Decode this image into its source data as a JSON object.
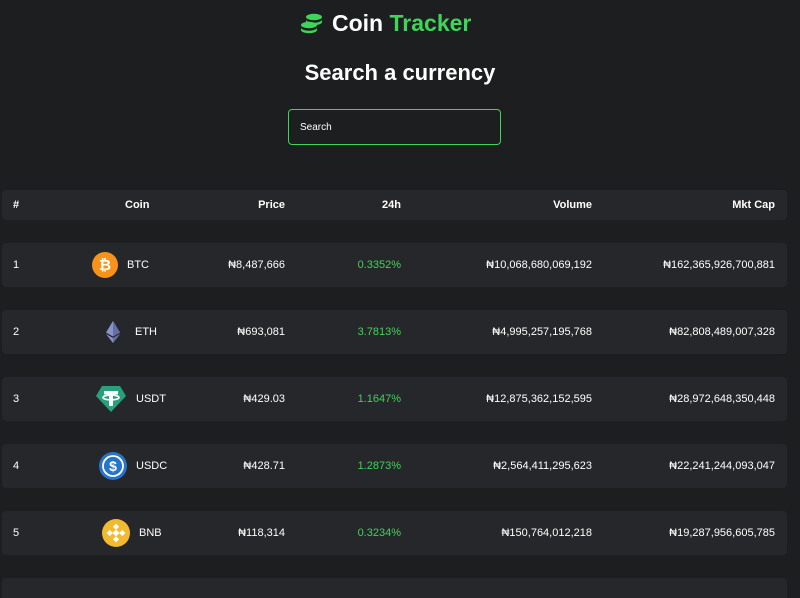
{
  "app": {
    "name_part1": "Coin",
    "name_part2": "Tracker",
    "accent_color": "#3fd45a"
  },
  "page_title": "Search a currency",
  "search": {
    "placeholder": "Search",
    "value": ""
  },
  "table": {
    "columns": [
      "#",
      "Coin",
      "Price",
      "24h",
      "Volume",
      "Mkt Cap"
    ],
    "rows": [
      {
        "rank": "1",
        "symbol": "BTC",
        "icon": "bitcoin-icon",
        "price": "₦8,487,666",
        "change": "0.3352%",
        "volume": "₦10,068,680,069,192",
        "mkt_cap": "₦162,365,926,700,881"
      },
      {
        "rank": "2",
        "symbol": "ETH",
        "icon": "ethereum-icon",
        "price": "₦693,081",
        "change": "3.7813%",
        "volume": "₦4,995,257,195,768",
        "mkt_cap": "₦82,808,489,007,328"
      },
      {
        "rank": "3",
        "symbol": "USDT",
        "icon": "tether-icon",
        "price": "₦429.03",
        "change": "1.1647%",
        "volume": "₦12,875,362,152,595",
        "mkt_cap": "₦28,972,648,350,448"
      },
      {
        "rank": "4",
        "symbol": "USDC",
        "icon": "usdc-icon",
        "price": "₦428.71",
        "change": "1.2873%",
        "volume": "₦2,564,411,295,623",
        "mkt_cap": "₦22,241,244,093,047"
      },
      {
        "rank": "5",
        "symbol": "BNB",
        "icon": "bnb-icon",
        "price": "₦118,314",
        "change": "0.3234%",
        "volume": "₦150,764,012,218",
        "mkt_cap": "₦19,287,956,605,785"
      }
    ]
  }
}
